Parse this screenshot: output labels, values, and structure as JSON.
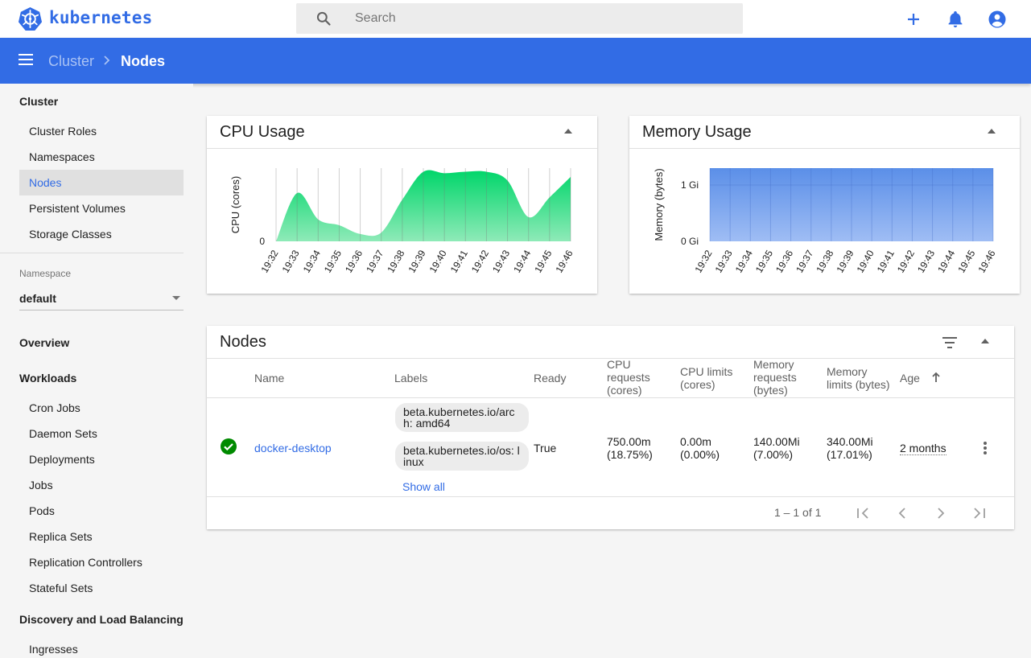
{
  "app": {
    "brand": "kubernetes",
    "search_placeholder": "Search"
  },
  "breadcrumb": {
    "parent": "Cluster",
    "current": "Nodes"
  },
  "colors": {
    "primary": "#326ce5",
    "cpu": "#00c853",
    "memory": "#6d9eeb",
    "ready": "#008a00"
  },
  "icons": {
    "add": "add-icon",
    "notifications": "bell-icon",
    "account": "account-circle-icon",
    "menu": "menu-icon"
  },
  "sidebar": {
    "cluster_heading": "Cluster",
    "cluster_items": [
      "Cluster Roles",
      "Namespaces",
      "Nodes",
      "Persistent Volumes",
      "Storage Classes"
    ],
    "namespace_label": "Namespace",
    "namespace_value": "default",
    "overview": "Overview",
    "workloads_heading": "Workloads",
    "workload_items": [
      "Cron Jobs",
      "Daemon Sets",
      "Deployments",
      "Jobs",
      "Pods",
      "Replica Sets",
      "Replication Controllers",
      "Stateful Sets"
    ],
    "discovery_heading": "Discovery and Load Balancing",
    "discovery_items": [
      "Ingresses"
    ]
  },
  "cpu_card": {
    "title": "CPU Usage"
  },
  "memory_card": {
    "title": "Memory Usage"
  },
  "chart_data": [
    {
      "type": "area",
      "title": "CPU Usage",
      "xlabel": "",
      "ylabel": "CPU (cores)",
      "x": [
        "19:32",
        "19:33",
        "19:34",
        "19:35",
        "19:36",
        "19:37",
        "19:38",
        "19:39",
        "19:40",
        "19:41",
        "19:42",
        "19:43",
        "19:44",
        "19:45",
        "19:46"
      ],
      "y_ticks": [
        "0"
      ],
      "series": [
        {
          "values": [
            0.0,
            0.66,
            0.3,
            0.22,
            0.1,
            0.12,
            0.57,
            0.95,
            0.93,
            0.95,
            0.95,
            0.83,
            0.33,
            0.6,
            0.88
          ]
        }
      ],
      "ylim": [
        0,
        1
      ],
      "grid": true
    },
    {
      "type": "area",
      "title": "Memory Usage",
      "xlabel": "",
      "ylabel": "Memory (bytes)",
      "x": [
        "19:32",
        "19:33",
        "19:34",
        "19:35",
        "19:36",
        "19:37",
        "19:38",
        "19:39",
        "19:40",
        "19:41",
        "19:42",
        "19:43",
        "19:44",
        "19:45",
        "19:46"
      ],
      "y_ticks": [
        "0 Gi",
        "1 Gi"
      ],
      "series": [
        {
          "values": [
            1.3,
            1.3,
            1.3,
            1.3,
            1.3,
            1.3,
            1.3,
            1.3,
            1.3,
            1.3,
            1.3,
            1.3,
            1.3,
            1.3,
            1.3
          ]
        }
      ],
      "ylim": [
        0,
        1.3
      ],
      "grid": true
    }
  ],
  "nodes_card": {
    "title": "Nodes",
    "headers": {
      "name": "Name",
      "labels": "Labels",
      "ready": "Ready",
      "cpu_requests": "CPU requests (cores)",
      "cpu_limits": "CPU limits (cores)",
      "mem_requests": "Memory requests (bytes)",
      "mem_limits": "Memory limits (bytes)",
      "age": "Age"
    },
    "rows": [
      {
        "name": "docker-desktop",
        "labels": [
          "beta.kubernetes.io/arch: amd64",
          "beta.kubernetes.io/os: linux"
        ],
        "show_all": "Show all",
        "ready": "True",
        "cpu_requests": "750.00m (18.75%)",
        "cpu_limits": "0.00m (0.00%)",
        "mem_requests": "140.00Mi (7.00%)",
        "mem_limits": "340.00Mi (17.01%)",
        "age": "2 months"
      }
    ],
    "pagination": "1 – 1 of 1"
  }
}
